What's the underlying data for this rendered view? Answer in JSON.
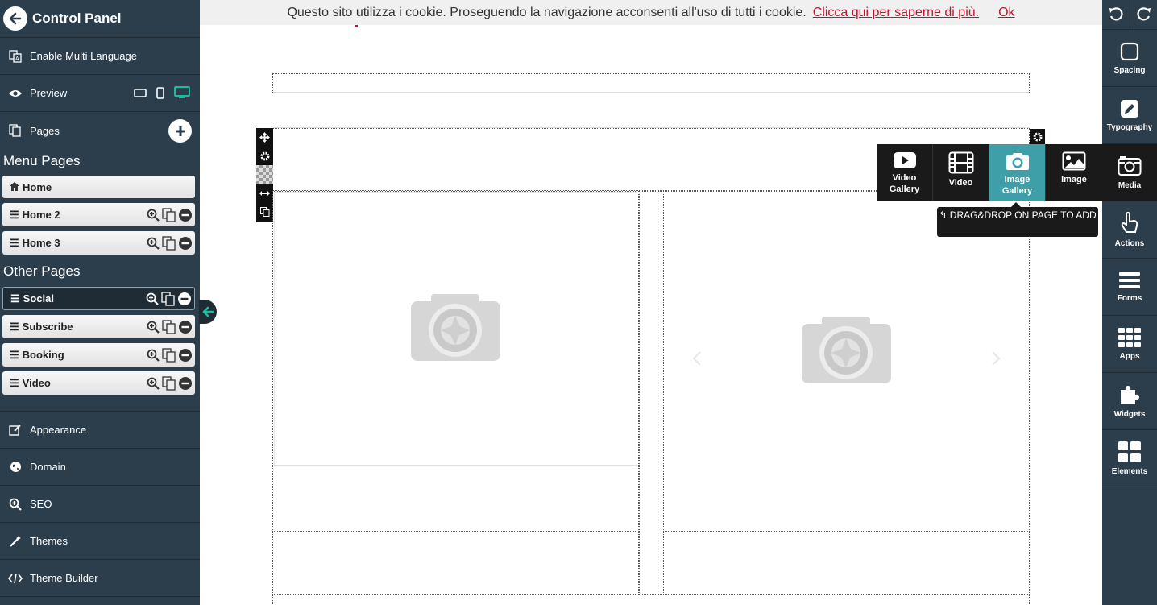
{
  "left_panel": {
    "title": "Control Panel",
    "enable_multi_language": "Enable Multi Language",
    "preview": "Preview",
    "pages": "Pages",
    "menu_pages_title": "Menu Pages",
    "menu_pages": [
      {
        "label": "Home",
        "icon": "home-icon"
      },
      {
        "label": "Home 2",
        "icon": "hamburger-icon"
      },
      {
        "label": "Home 3",
        "icon": "hamburger-icon"
      }
    ],
    "other_pages_title": "Other Pages",
    "other_pages": [
      {
        "label": "Social"
      },
      {
        "label": "Subscribe"
      },
      {
        "label": "Booking"
      },
      {
        "label": "Video"
      }
    ],
    "bottom_items": [
      {
        "label": "Appearance",
        "icon": "edit-icon"
      },
      {
        "label": "Domain",
        "icon": "globe-icon"
      },
      {
        "label": "SEO",
        "icon": "search-icon"
      },
      {
        "label": "Themes",
        "icon": "magic-wand-icon"
      },
      {
        "label": "Theme Builder",
        "icon": "code-icon"
      }
    ],
    "accent_color": "#1abc9c"
  },
  "cookie_bar": {
    "text": "Questo sito utilizza i cookie. Proseguendo la navigazione acconsenti all'uso di tutti i cookie.",
    "link": "Clicca qui per saperne di più.",
    "ok": "Ok",
    "link_color": "#c8102e"
  },
  "media_popout": {
    "items": [
      {
        "label_1": "Video",
        "label_2": "Gallery",
        "icon": "youtube-icon"
      },
      {
        "label_1": "Video",
        "label_2": "",
        "icon": "film-icon"
      },
      {
        "label_1": "Image",
        "label_2": "Gallery",
        "icon": "camera-icon"
      },
      {
        "label_1": "Image",
        "label_2": "",
        "icon": "picture-icon"
      }
    ],
    "active_color": "#3e9fa8",
    "tooltip": "DRAG&DROP ON PAGE TO ADD"
  },
  "right_toolbar": {
    "items": [
      {
        "label": "Spacing",
        "icon": "square-icon"
      },
      {
        "label": "Typography",
        "icon": "pencil-icon"
      },
      {
        "label": "Media",
        "icon": "media-icon"
      },
      {
        "label": "Actions",
        "icon": "hand-pointer-icon"
      },
      {
        "label": "Forms",
        "icon": "bars-icon"
      },
      {
        "label": "Apps",
        "icon": "grid-icon"
      },
      {
        "label": "Widgets",
        "icon": "puzzle-icon"
      },
      {
        "label": "Elements",
        "icon": "elements-icon"
      }
    ]
  }
}
